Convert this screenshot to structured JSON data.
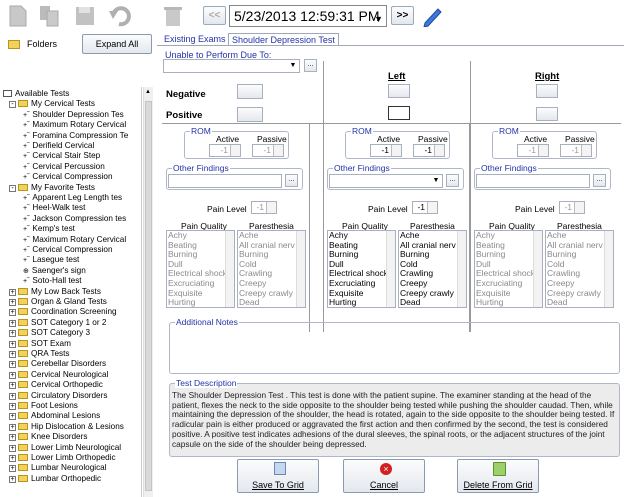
{
  "toolbar": {
    "datetime": "5/23/2013 12:59:31 PM",
    "prev_label": "<<",
    "next_label": ">>",
    "dropdown_arrow": "▼"
  },
  "left": {
    "folders_label": "Folders",
    "expand_all_label": "Expand All",
    "tree": [
      {
        "text": "Available Tests",
        "level": 0,
        "kind": "root"
      },
      {
        "text": "My Cervical Tests",
        "level": 1,
        "kind": "folder",
        "sign": "-"
      },
      {
        "text": "Shoulder Depression Tes",
        "level": 2,
        "kind": "item"
      },
      {
        "text": "Maximum Rotary Cervical",
        "level": 2,
        "kind": "item"
      },
      {
        "text": "Foramina Compression Te",
        "level": 2,
        "kind": "item"
      },
      {
        "text": "Derifield Cervical",
        "level": 2,
        "kind": "item"
      },
      {
        "text": "Cervical Stair Step",
        "level": 2,
        "kind": "item"
      },
      {
        "text": "Cervical Percussion",
        "level": 2,
        "kind": "item"
      },
      {
        "text": "Cervical Compression",
        "level": 2,
        "kind": "item"
      },
      {
        "text": "My Favorite Tests",
        "level": 1,
        "kind": "folder",
        "sign": "-"
      },
      {
        "text": "Apparent Leg Length tes",
        "level": 2,
        "kind": "item"
      },
      {
        "text": "Heel-Walk test",
        "level": 2,
        "kind": "item"
      },
      {
        "text": "Jackson Compression tes",
        "level": 2,
        "kind": "item"
      },
      {
        "text": "Kemp's test",
        "level": 2,
        "kind": "item"
      },
      {
        "text": "Maximum Rotary Cervical",
        "level": 2,
        "kind": "item"
      },
      {
        "text": "Cervical Compression",
        "level": 2,
        "kind": "item"
      },
      {
        "text": "Lasegue test",
        "level": 2,
        "kind": "item"
      },
      {
        "text": "Saenger's sign",
        "level": 2,
        "kind": "item2"
      },
      {
        "text": "Soto-Hall test",
        "level": 2,
        "kind": "item"
      },
      {
        "text": "My Low Back Tests",
        "level": 1,
        "kind": "folder",
        "sign": "+"
      },
      {
        "text": "Organ & Gland Tests",
        "level": 1,
        "kind": "folder",
        "sign": "+"
      },
      {
        "text": "Coordination Screening",
        "level": 1,
        "kind": "folder",
        "sign": "+"
      },
      {
        "text": "SOT Category 1 or 2",
        "level": 1,
        "kind": "folder",
        "sign": "+"
      },
      {
        "text": "SOT Category 3",
        "level": 1,
        "kind": "folder",
        "sign": "+"
      },
      {
        "text": "SOT Exam",
        "level": 1,
        "kind": "folder",
        "sign": "+"
      },
      {
        "text": "QRA Tests",
        "level": 1,
        "kind": "folder",
        "sign": "+"
      },
      {
        "text": "Cerebellar Disorders",
        "level": 1,
        "kind": "folder",
        "sign": "+"
      },
      {
        "text": "Cervical Neurological",
        "level": 1,
        "kind": "folder",
        "sign": "+"
      },
      {
        "text": "Cervical Orthopedic",
        "level": 1,
        "kind": "folder",
        "sign": "+"
      },
      {
        "text": "Circulatory Disorders",
        "level": 1,
        "kind": "folder",
        "sign": "+"
      },
      {
        "text": "Foot Lesions",
        "level": 1,
        "kind": "folder",
        "sign": "+"
      },
      {
        "text": "Abdominal Lesions",
        "level": 1,
        "kind": "folder",
        "sign": "+"
      },
      {
        "text": "Hip Dislocation & Lesions",
        "level": 1,
        "kind": "folder",
        "sign": "+"
      },
      {
        "text": "Knee Disorders",
        "level": 1,
        "kind": "folder",
        "sign": "+"
      },
      {
        "text": "Lower Limb Neurological",
        "level": 1,
        "kind": "folder",
        "sign": "+"
      },
      {
        "text": "Lower Limb Orthopedic",
        "level": 1,
        "kind": "folder",
        "sign": "+"
      },
      {
        "text": "Lumbar Neurological",
        "level": 1,
        "kind": "folder",
        "sign": "+"
      },
      {
        "text": "Lumbar Orthopedic",
        "level": 1,
        "kind": "folder",
        "sign": "+"
      }
    ]
  },
  "tabs": {
    "existing": "Existing Exams",
    "current": "Shoulder Depression Test"
  },
  "form": {
    "unable_label": "Unable to Perform Due To:",
    "negative_label": "Negative",
    "positive_label": "Positive",
    "left_label": "Left",
    "right_label": "Right",
    "rom_label": "ROM",
    "active_label": "Active",
    "passive_label": "Passive",
    "spin_value": "-1",
    "other_findings_label": "Other Findings",
    "pain_level_label": "Pain Level",
    "pain_quality_label": "Pain Quality",
    "paresthesia_label": "Paresthesia",
    "pain_quality_items": [
      "Achy",
      "Beating",
      "Burning",
      "Dull",
      "Electrical shock",
      "Excruciating",
      "Exquisite",
      "Hurting"
    ],
    "paresthesia_items": [
      "Ache",
      "All cranial nerv",
      "Burning",
      "Cold",
      "Crawling",
      "Creepy",
      "Creepy crawly",
      "Dead"
    ],
    "dots": "...",
    "additional_notes_label": "Additional Notes",
    "test_description_label": "Test Description",
    "test_description": "The Shoulder Depression Test . This test is done with the patient supine. The examiner standing at the head of the patient, flexes the neck to the side opposite to the shoulder being tested while pushing the shoulder caudad. Then, while maintaining the depression of the shoulder, the head is rotated, again to the side opposite to the shoulder being tested. If radicular pain is either produced or aggravated the first action and then confirmed by the second, the test is considered positive. A positive test indicates adhesions of the dural sleeves, the spinal roots, or the adjacent structures of the joint capsule on the side of the shoulder being depressed."
  },
  "buttons": {
    "save": "Save To Grid",
    "cancel": "Cancel",
    "delete": "Delete From Grid"
  }
}
